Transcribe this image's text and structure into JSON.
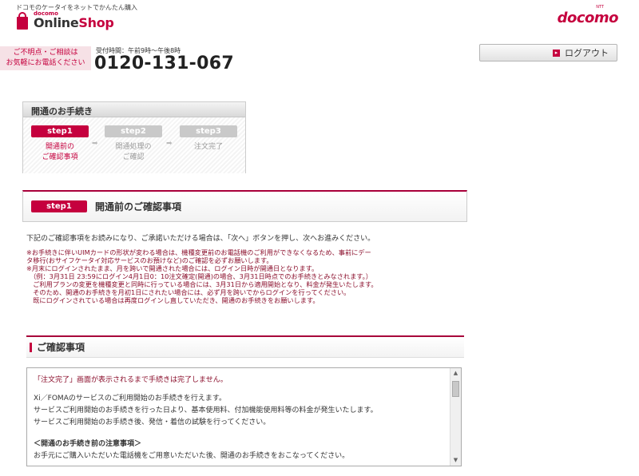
{
  "header": {
    "tagline": "ドコモのケータイをネットでかんたん購入",
    "logo_small": "docomo",
    "logo_online": "Online",
    "logo_shop": "Shop",
    "brand_ntt": "NTT",
    "brand": "docomo"
  },
  "contact": {
    "line1": "ご不明点・ご相談は",
    "line2": "お気軽にお電話ください",
    "hours": "受付時間：午前9時〜午後8時",
    "phone": "0120-131-067"
  },
  "logout": {
    "label": "ログアウト",
    "arrow": "▸"
  },
  "steps": {
    "title": "開通のお手続き",
    "items": [
      {
        "label": "step1",
        "cap1": "開通前の",
        "cap2": "ご確認事項"
      },
      {
        "label": "step2",
        "cap1": "開通処理の",
        "cap2": "ご確認"
      },
      {
        "label": "step3",
        "cap1": "注文完了",
        "cap2": ""
      }
    ],
    "arrow": "➡"
  },
  "section": {
    "pill": "step1",
    "title": "開通前のご確認事項"
  },
  "intro": "下記のご確認事項をお読みになり、ご承諾いただける場合は、「次へ」ボタンを押し、次へお進みください。",
  "notes": [
    "※お手続きに伴いUIMカードの形状が変わる場合は、機種変更前のお電話機のご利用ができなくなるため、事前にデー",
    "タ移行(おサイフケータイ対応サービスのお預けなど)のご確認を必ずお願いします。",
    "※月末にログインされたまま、月を跨いで開通された場合には、ログイン日時が開通日となります。",
    "　（例：3月31日 23:59にログイン4月1日0：10注文確定(開通)の場合、3月31日時点でのお手続きとみなされます。）",
    "　ご利用プランの変更を機種変更と同時に行っている場合には、3月31日から適用開始となり、料金が発生いたします。",
    "　そのため、開通のお手続きを月初1日にされたい場合には、必ず月を跨いでからログインを行ってください。",
    "　既にログインされている場合は再度ログインし直していただき、開通のお手続きをお願いします。"
  ],
  "confirm": {
    "title": "ご確認事項",
    "red_line": "「注文完了」画面が表示されるまで手続きは完了しません。",
    "lines": [
      "Xi／FOMAのサービスのご利用開始のお手続きを行えます。",
      "サービスご利用開始のお手続きを行った日より、基本使用料、付加機能使用料等の料金が発生いたします。",
      "サービスご利用開始のお手続き後、発信・着信の試験を行ってください。"
    ],
    "subheading": "＜開通のお手続き前の注意事項＞",
    "last_line": "お手元にご購入いただいた電話機をご用意いただいた後、開通のお手続きをおこなってください。"
  },
  "scroll": {
    "up": "▲",
    "down": "▼"
  }
}
